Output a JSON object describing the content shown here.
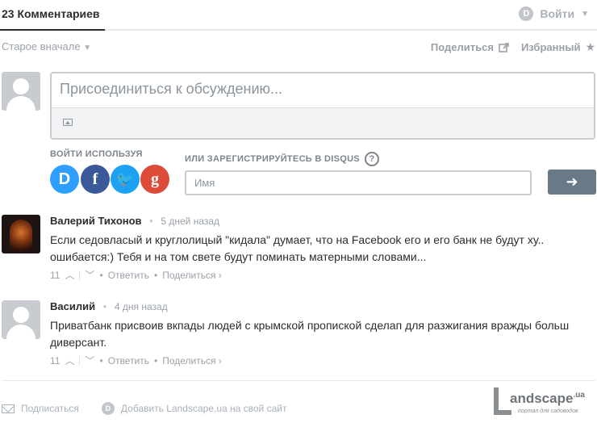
{
  "header": {
    "comment_count": "23 Комментариев",
    "login_label": "Войти",
    "disqus_badge": "D"
  },
  "toolbar": {
    "sort_label": "Старое вначале",
    "share_label": "Поделиться",
    "favorites_label": "Избранный"
  },
  "composer": {
    "placeholder": "Присоединиться к обсуждению...",
    "login_with_label": "ВОЙТИ ИСПОЛЬЗУЯ",
    "register_label": "ИЛИ ЗАРЕГИСТРИРУЙТЕСЬ В DISQUS",
    "help_glyph": "?",
    "name_placeholder": "Имя",
    "submit_glyph": "➜",
    "social": {
      "disqus": "D",
      "facebook": "f",
      "twitter": "🐦",
      "google": "g"
    }
  },
  "comments": [
    {
      "author": "Валерий Тихонов",
      "time": "5 дней назад",
      "text_line1": "Если седовласый и круглолицый \"кидала\" думает, что на Facebook его и его банк не будут ху..",
      "text_line2": "ошибается:) Тебя и на том свете будут поминать матерными словами...",
      "votes": "11",
      "reply_label": "Ответить",
      "share_label": "Поделиться ›"
    },
    {
      "author": "Василий",
      "time": "4 дня назад",
      "text_line1": "Приватбанк присвоив вкпады людей с крымской пропиской сделап для разжигания вражды больш",
      "text_line2": "диверсант.",
      "votes": "11",
      "reply_label": "Ответить",
      "share_label": "Поделиться ›"
    }
  ],
  "footer": {
    "subscribe_label": "Подписаться",
    "add_disqus_label": "Добавить Landscape.ua на свой сайт"
  },
  "watermark": {
    "brand": "andscape",
    "tld": ".ua",
    "tagline": "портал для садоводов"
  }
}
